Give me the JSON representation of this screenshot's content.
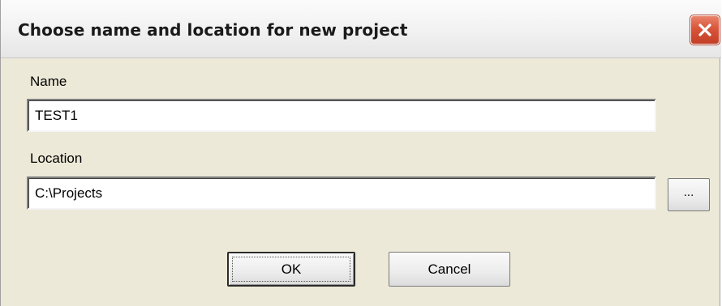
{
  "window": {
    "title": "Choose name and location for new project",
    "close_icon": "close-icon",
    "close_color": "#d9553a"
  },
  "form": {
    "name_label": "Name",
    "name_value": "TEST1",
    "location_label": "Location",
    "location_value": "C:\\Projects",
    "browse_label": "..."
  },
  "buttons": {
    "ok_label": "OK",
    "cancel_label": "Cancel"
  }
}
